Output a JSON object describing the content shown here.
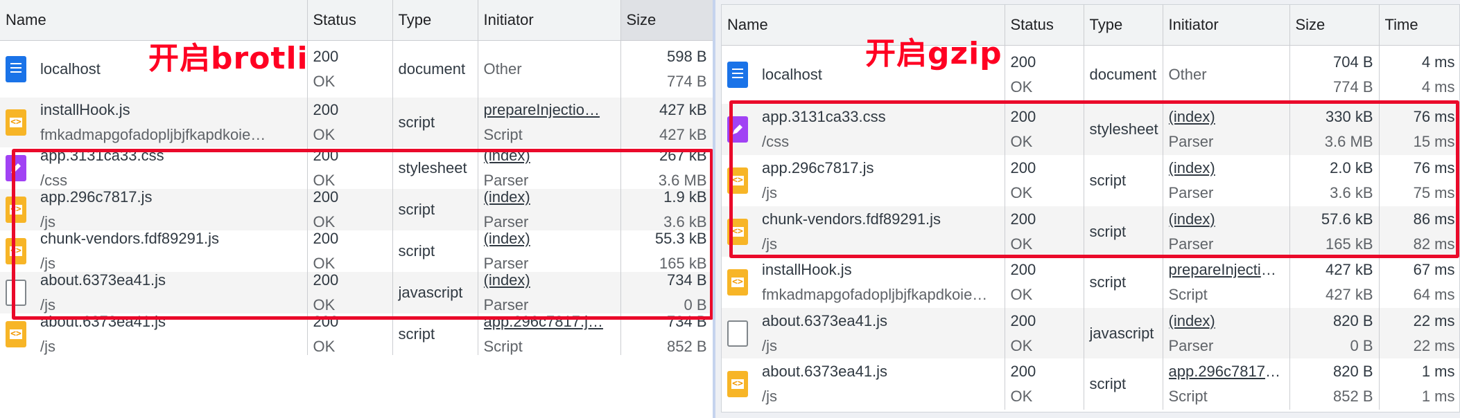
{
  "left": {
    "annotation": "开启brotli",
    "headers": {
      "name": "Name",
      "status": "Status",
      "type": "Type",
      "initiator": "Initiator",
      "size": "Size"
    },
    "rows": [
      {
        "icon": "document-icon",
        "name": "localhost",
        "path": "",
        "status": "200",
        "status_text": "OK",
        "type": "document",
        "initiator": "Other",
        "initiator_sub": "",
        "initiator_link": false,
        "size": "598 B",
        "resource": "774 B"
      },
      {
        "icon": "script-icon",
        "name": "installHook.js",
        "path": "fmkadmapgofadopljbjfkapdkoie…",
        "status": "200",
        "status_text": "OK",
        "type": "script",
        "initiator": "prepareInjectio…",
        "initiator_sub": "Script",
        "initiator_link": true,
        "size": "427 kB",
        "resource": "427 kB"
      },
      {
        "icon": "stylesheet-icon",
        "name": "app.3131ca33.css",
        "path": "/css",
        "status": "200",
        "status_text": "OK",
        "type": "stylesheet",
        "initiator": "(index)",
        "initiator_sub": "Parser",
        "initiator_link": true,
        "size": "267 kB",
        "resource": "3.6 MB"
      },
      {
        "icon": "script-icon",
        "name": "app.296c7817.js",
        "path": "/js",
        "status": "200",
        "status_text": "OK",
        "type": "script",
        "initiator": "(index)",
        "initiator_sub": "Parser",
        "initiator_link": true,
        "size": "1.9 kB",
        "resource": "3.6 kB"
      },
      {
        "icon": "script-icon",
        "name": "chunk-vendors.fdf89291.js",
        "path": "/js",
        "status": "200",
        "status_text": "OK",
        "type": "script",
        "initiator": "(index)",
        "initiator_sub": "Parser",
        "initiator_link": true,
        "size": "55.3 kB",
        "resource": "165 kB"
      },
      {
        "icon": "other-icon",
        "name": "about.6373ea41.js",
        "path": "/js",
        "status": "200",
        "status_text": "OK",
        "type": "javascript",
        "initiator": "(index)",
        "initiator_sub": "Parser",
        "initiator_link": true,
        "size": "734 B",
        "resource": "0 B"
      },
      {
        "icon": "script-icon",
        "name": "about.6373ea41.js",
        "path": "/js",
        "status": "200",
        "status_text": "OK",
        "type": "script",
        "initiator": "app.296c7817.j…",
        "initiator_sub": "Script",
        "initiator_link": true,
        "size": "734 B",
        "resource": "852 B"
      }
    ]
  },
  "right": {
    "annotation": "开启gzip",
    "headers": {
      "name": "Name",
      "status": "Status",
      "type": "Type",
      "initiator": "Initiator",
      "size": "Size",
      "time": "Time"
    },
    "rows": [
      {
        "icon": "document-icon",
        "name": "localhost",
        "path": "",
        "status": "200",
        "status_text": "OK",
        "type": "document",
        "initiator": "Other",
        "initiator_sub": "",
        "initiator_link": false,
        "size": "704 B",
        "resource": "774 B",
        "time": "4 ms",
        "latency": "4 ms"
      },
      {
        "icon": "stylesheet-icon",
        "name": "app.3131ca33.css",
        "path": "/css",
        "status": "200",
        "status_text": "OK",
        "type": "stylesheet",
        "initiator": "(index)",
        "initiator_sub": "Parser",
        "initiator_link": true,
        "size": "330 kB",
        "resource": "3.6 MB",
        "time": "76 ms",
        "latency": "15 ms"
      },
      {
        "icon": "script-icon",
        "name": "app.296c7817.js",
        "path": "/js",
        "status": "200",
        "status_text": "OK",
        "type": "script",
        "initiator": "(index)",
        "initiator_sub": "Parser",
        "initiator_link": true,
        "size": "2.0 kB",
        "resource": "3.6 kB",
        "time": "76 ms",
        "latency": "75 ms"
      },
      {
        "icon": "script-icon",
        "name": "chunk-vendors.fdf89291.js",
        "path": "/js",
        "status": "200",
        "status_text": "OK",
        "type": "script",
        "initiator": "(index)",
        "initiator_sub": "Parser",
        "initiator_link": true,
        "size": "57.6 kB",
        "resource": "165 kB",
        "time": "86 ms",
        "latency": "82 ms"
      },
      {
        "icon": "script-icon",
        "name": "installHook.js",
        "path": "fmkadmapgofadopljbjfkapdkoie…",
        "status": "200",
        "status_text": "OK",
        "type": "script",
        "initiator": "prepareInjectio…",
        "initiator_sub": "Script",
        "initiator_link": true,
        "size": "427 kB",
        "resource": "427 kB",
        "time": "67 ms",
        "latency": "64 ms"
      },
      {
        "icon": "other-icon",
        "name": "about.6373ea41.js",
        "path": "/js",
        "status": "200",
        "status_text": "OK",
        "type": "javascript",
        "initiator": "(index)",
        "initiator_sub": "Parser",
        "initiator_link": true,
        "size": "820 B",
        "resource": "0 B",
        "time": "22 ms",
        "latency": "22 ms"
      },
      {
        "icon": "script-icon",
        "name": "about.6373ea41.js",
        "path": "/js",
        "status": "200",
        "status_text": "OK",
        "type": "script",
        "initiator": "app.296c7817.j…",
        "initiator_sub": "Script",
        "initiator_link": true,
        "size": "820 B",
        "resource": "852 B",
        "time": "1 ms",
        "latency": "1 ms"
      }
    ]
  },
  "colors": {
    "annotation": "#ff0022",
    "highlight_box": "#ea0a2a",
    "document_icon": "#1a73e8",
    "stylesheet_icon": "#a142f4",
    "script_icon": "#f7b527"
  }
}
